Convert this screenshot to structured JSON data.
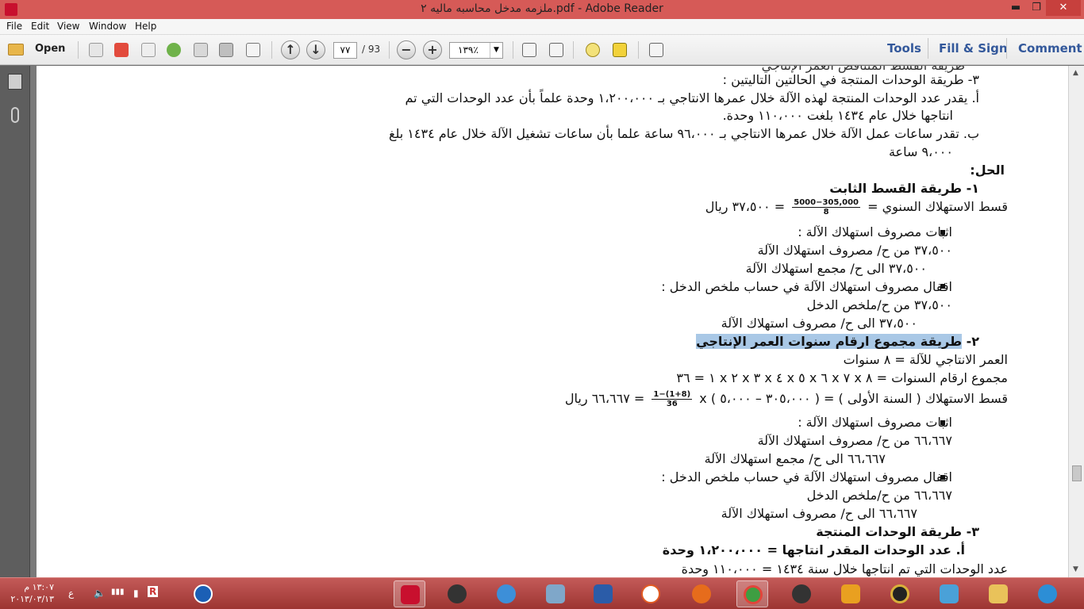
{
  "window": {
    "title": "ملزمه مدخل محاسبه ماليه ٢.pdf - Adobe Reader",
    "minimize": "▬",
    "restore": "❐",
    "close": "✕"
  },
  "menu": [
    "File",
    "Edit",
    "View",
    "Window",
    "Help"
  ],
  "toolbar": {
    "open_label": "Open",
    "page_current": "٧٧",
    "page_total": "/ 93",
    "zoom_value": "١٣٩٪",
    "tools_label": "Tools",
    "fill_sign_label": "Fill & Sign",
    "comment_label": "Comment"
  },
  "document": {
    "line_partial": "ﻃﺮﻳﻘﺔ ﺍﻟﻘﺴﻂ ﺍﻟﻤﺘﻨﺎﻗﺺ ﺍﻟﻌﻤﺮ ﺍﻹﻧﺘﺎﺟﻲ",
    "q3": "٣- طريقة الوحدات المنتجة في الحالتين التاليتين :",
    "q3a1": "أ.   يقدر عدد الوحدات المنتجة لهذه الآلة خلال عمرها الانتاجي بـ ١،٢٠٠،٠٠٠ وحدة علماً بأن عدد الوحدات التي تم",
    "q3a2": "انتاجها خلال عام ١٤٣٤ بلغت ١١٠،٠٠٠ وحدة.",
    "q3b1": "ب.   تقدر ساعات عمل الآلة خلال عمرها الانتاجي بـ ٩٦،٠٠٠ ساعة علما بأن ساعات تشغيل الآلة خلال عام ١٤٣٤ بلغ",
    "q3b2": "٩،٠٠٠ ساعة",
    "solution": "الحل:",
    "m1": "١-  طريقة القسط الثابت",
    "m1_formula_left": "قسط الاستهلاك السنوي =",
    "m1_frac_num": "5000−305,000",
    "m1_frac_den": "8",
    "m1_formula_right": "= ٣٧،٥٠٠ ريال",
    "m1_b1": "اثبات مصروف استهلاك الآلة :",
    "m1_b1_l1": "٣٧،٥٠٠ من ح/ مصروف استهلاك الآلة",
    "m1_b1_l2": "٣٧،٥٠٠ الى ح/ مجمع استهلاك الآلة",
    "m1_b2": "اقفال مصروف استهلاك الآلة في حساب ملخص الدخل :",
    "m1_b2_l1": "٣٧،٥٠٠ من ح/ملخص الدخل",
    "m1_b2_l2": "٣٧،٥٠٠ الى ح/ مصروف استهلاك الآلة",
    "m2_num": "٢-",
    "m2_title": "طريقة مجموع ارقام سنوات العمر الإنتاجي",
    "m2_l1": "العمر الانتاجي للآلة = ٨ سنوات",
    "m2_l2": "مجموع ارقام السنوات = ٨ x ٧ x ٦ x ٥ x ٤ x ٣ x ٢ x ١ = ٣٦",
    "m2_l3_left": "قسط الاستهلاك ( السنة الأولى ) = ( ٣٠٥،٠٠٠ – ٥،٠٠٠ ) x",
    "m2_frac_num": "1−(1+8)",
    "m2_frac_den": "36",
    "m2_l3_right": "= ٦٦،٦٦٧ ريال",
    "m2_b1": "اثبات مصروف استهلاك الآلة :",
    "m2_b1_l1": "٦٦،٦٦٧ من ح/ مصروف استهلاك الآلة",
    "m2_b1_l2": "٦٦،٦٦٧ الى ح/ مجمع استهلاك الآلة",
    "m2_b2": "اقفال مصروف استهلاك الآلة في حساب ملخص الدخل :",
    "m2_b2_l1": "٦٦،٦٦٧ من ح/ملخص الدخل",
    "m2_b2_l2": "٦٦،٦٦٧  الى ح/ مصروف استهلاك الآلة",
    "m3": "٣-  طريقة الوحدات المنتجة",
    "m3_a": "أ.    عدد الوحدات المقدر انتاجها = ١،٢٠٠،٠٠٠ وحدة",
    "m3_last": "عدد الوحدات التي تم انتاجها خلال سنة ١٤٣٤ = ١١٠،٠٠٠ وحدة"
  },
  "taskbar": {
    "time": "١٣:٠٧ م",
    "date": "٢٠١٣/٠٣/١٣",
    "lang": "ع"
  },
  "colors": {
    "titlebar": "#d65a57",
    "taskbar": "#b04744",
    "highlight": "#a9c8e6",
    "link_blue": "#33589b"
  }
}
